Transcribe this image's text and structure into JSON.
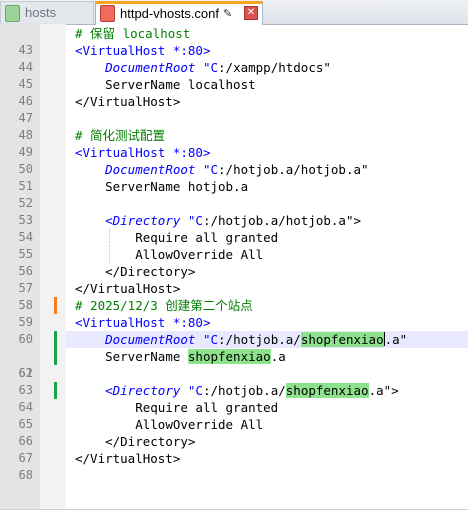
{
  "tabs": [
    {
      "label": "hosts",
      "active": false
    },
    {
      "label": "httpd-vhosts.conf",
      "active": true
    }
  ],
  "colors": {
    "modified": "#f57c1f",
    "saved": "#19a34a",
    "highlight": "#8ee28e",
    "keyword": "#0000ff",
    "comment": "#008000"
  },
  "lines": [
    {
      "n": "43",
      "text": "# 保留 localhost"
    },
    {
      "n": "44",
      "text": "<VirtualHost *:80>"
    },
    {
      "n": "45",
      "text": "DocumentRoot \"C:/xampp/htdocs\""
    },
    {
      "n": "46",
      "text": "ServerName localhost"
    },
    {
      "n": "47",
      "text": "</VirtualHost>"
    },
    {
      "n": "48",
      "text": ""
    },
    {
      "n": "49",
      "text": "# 简化测试配置"
    },
    {
      "n": "50",
      "text": "<VirtualHost *:80>"
    },
    {
      "n": "51",
      "text": "DocumentRoot \"C:/hotjob.a/hotjob.a\""
    },
    {
      "n": "52",
      "text": "ServerName hotjob.a"
    },
    {
      "n": "53",
      "text": ""
    },
    {
      "n": "54",
      "text": "<Directory \"C:/hotjob.a/hotjob.a\">"
    },
    {
      "n": "55",
      "text": "Require all granted"
    },
    {
      "n": "56",
      "text": "AllowOverride All"
    },
    {
      "n": "57",
      "text": "</Directory>"
    },
    {
      "n": "58",
      "text": "</VirtualHost>"
    },
    {
      "n": "59",
      "text": "# 2025/12/3 创建第二个站点"
    },
    {
      "n": "60",
      "text": "<VirtualHost *:80>"
    },
    {
      "n": "61",
      "text": "DocumentRoot \"C:/hotjob.a/shopfenxiao.a\""
    },
    {
      "n": "62",
      "text": "ServerName shopfenxiao.a"
    },
    {
      "n": "63",
      "text": ""
    },
    {
      "n": "64",
      "text": "<Directory \"C:/hotjob.a/shopfenxiao.a\">"
    },
    {
      "n": "65",
      "text": "Require all granted"
    },
    {
      "n": "66",
      "text": "AllowOverride All"
    },
    {
      "n": "67",
      "text": "</Directory>"
    },
    {
      "n": "68",
      "text": "</VirtualHost>"
    }
  ],
  "tokens": {
    "l43_comment": "# 保留 localhost",
    "vh_open": "<VirtualHost",
    "vh_star": " *",
    "vh_port": ":80>",
    "vh_close": "</VirtualHost>",
    "docroot": "DocumentRoot",
    "servername": "ServerName",
    "l45_val_a": "\"C",
    "l45_val_b": ":/xampp/htdocs\"",
    "l46_val": "localhost",
    "l49_comment": "# 简化测试配置",
    "l51_val_a": "\"C",
    "l51_val_b": ":/hotjob.a/hotjob.a\"",
    "l52_val": "hotjob.a",
    "dir_open": "<Directory",
    "l54_val_a": "\"C",
    "l54_val_b": ":/hotjob.a/hotjob.a\">",
    "require": "Require all granted",
    "allow": "AllowOverride All",
    "dir_close": "</Directory>",
    "l59_comment": "# 2025/12/3 创建第二个站点",
    "l61_val_a": "\"C",
    "l61_val_b": ":/hotjob.a/",
    "l61_hl": "shopfenxiao",
    "l61_val_c": ".a\"",
    "l62_hl": "shopfenxiao",
    "l62_val_c": ".a",
    "l64_val_a": "\"C",
    "l64_val_b": ":/hotjob.a/",
    "l64_hl": "shopfenxiao",
    "l64_val_c": ".a\">"
  }
}
